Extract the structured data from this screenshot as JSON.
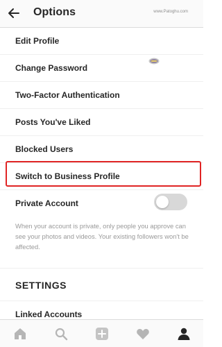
{
  "header": {
    "title": "Options",
    "watermark": "www.Patoghu.com"
  },
  "menu": {
    "items": [
      {
        "label": "Edit Profile"
      },
      {
        "label": "Change Password"
      },
      {
        "label": "Two-Factor Authentication"
      },
      {
        "label": "Posts You've Liked"
      },
      {
        "label": "Blocked Users"
      },
      {
        "label": "Switch to Business Profile"
      }
    ],
    "highlight_color": "#e02424"
  },
  "private_account": {
    "label": "Private Account",
    "enabled": false,
    "note": "When your account is private, only people you approve can see your photos and videos. Your existing followers won't be affected."
  },
  "settings": {
    "title": "SETTINGS",
    "items": [
      {
        "label": "Linked Accounts"
      }
    ]
  },
  "tabbar": {
    "icons": [
      "home-icon",
      "search-icon",
      "add-post-icon",
      "activity-heart-icon",
      "profile-icon"
    ],
    "active": "profile-icon"
  }
}
